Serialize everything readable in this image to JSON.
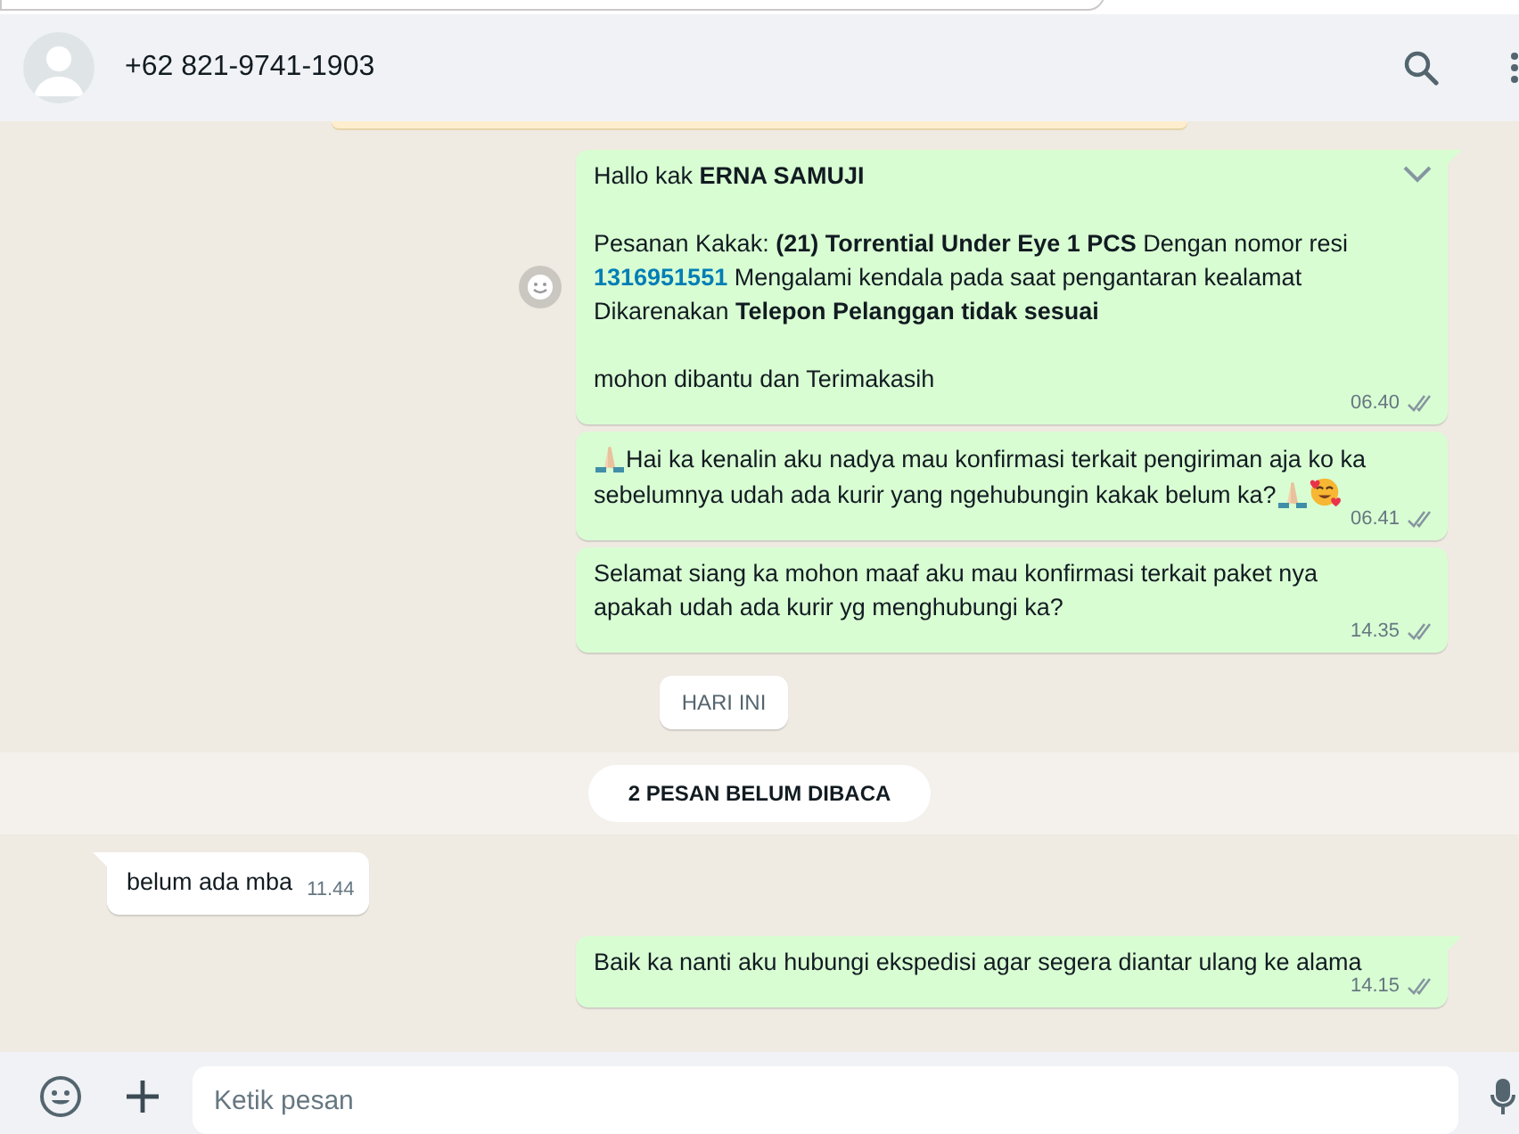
{
  "header": {
    "contact": "+62 821-9741-1903"
  },
  "chat": [
    {
      "kind": "notice"
    },
    {
      "kind": "out",
      "tail": true,
      "menu": true,
      "react": true,
      "time": "06.40",
      "read": false,
      "paragraphs": [
        [
          {
            "kind": "text",
            "text": "Hallo kak **ERNA SAMUJI**"
          }
        ],
        [
          {
            "kind": "text",
            "text": "Pesanan Kakak: **(21) Torrential Under Eye 1 PCS** Dengan nomor resi "
          },
          {
            "kind": "link",
            "text": "1316951551"
          },
          {
            "kind": "text",
            "text": " Mengalami kendala pada saat pengantaran kealamat Dikarenakan **Telepon Pelanggan tidak sesuai**"
          }
        ],
        [
          {
            "kind": "text",
            "text": "mohon dibantu dan Terimakasih"
          }
        ]
      ]
    },
    {
      "kind": "out",
      "tail": false,
      "menu": false,
      "react": false,
      "time": "06.41",
      "read": false,
      "paragraphs": [
        [
          {
            "kind": "hands"
          },
          {
            "kind": "text",
            "text": "Hai ka kenalin aku nadya mau konfirmasi terkait pengiriman aja ko ka sebelumnya udah ada kurir yang ngehubungin kakak belum ka?"
          },
          {
            "kind": "hands"
          },
          {
            "kind": "face"
          }
        ]
      ]
    },
    {
      "kind": "out",
      "tail": false,
      "menu": false,
      "react": false,
      "time": "14.35",
      "read": false,
      "paragraphs": [
        [
          {
            "kind": "text",
            "text": "Selamat siang ka mohon maaf aku mau konfirmasi terkait paket nya apakah udah ada kurir yg menghubungi ka?"
          }
        ]
      ]
    },
    {
      "kind": "date",
      "text": "HARI INI"
    },
    {
      "kind": "unread",
      "text": "2 PESAN BELUM DIBACA"
    },
    {
      "kind": "in",
      "tail": true,
      "menu": false,
      "react": false,
      "time": "11.44",
      "paragraphs": [
        [
          {
            "kind": "text",
            "text": "belum ada mba"
          }
        ]
      ]
    },
    {
      "kind": "out",
      "tail": true,
      "menu": false,
      "react": false,
      "time": "14.15",
      "read": false,
      "paragraphs": [
        [
          {
            "kind": "text",
            "text": "Baik ka nanti aku hubungi ekspedisi agar segera diantar ulang ke alama"
          }
        ]
      ]
    }
  ],
  "composer": {
    "placeholder": "Ketik pesan"
  }
}
